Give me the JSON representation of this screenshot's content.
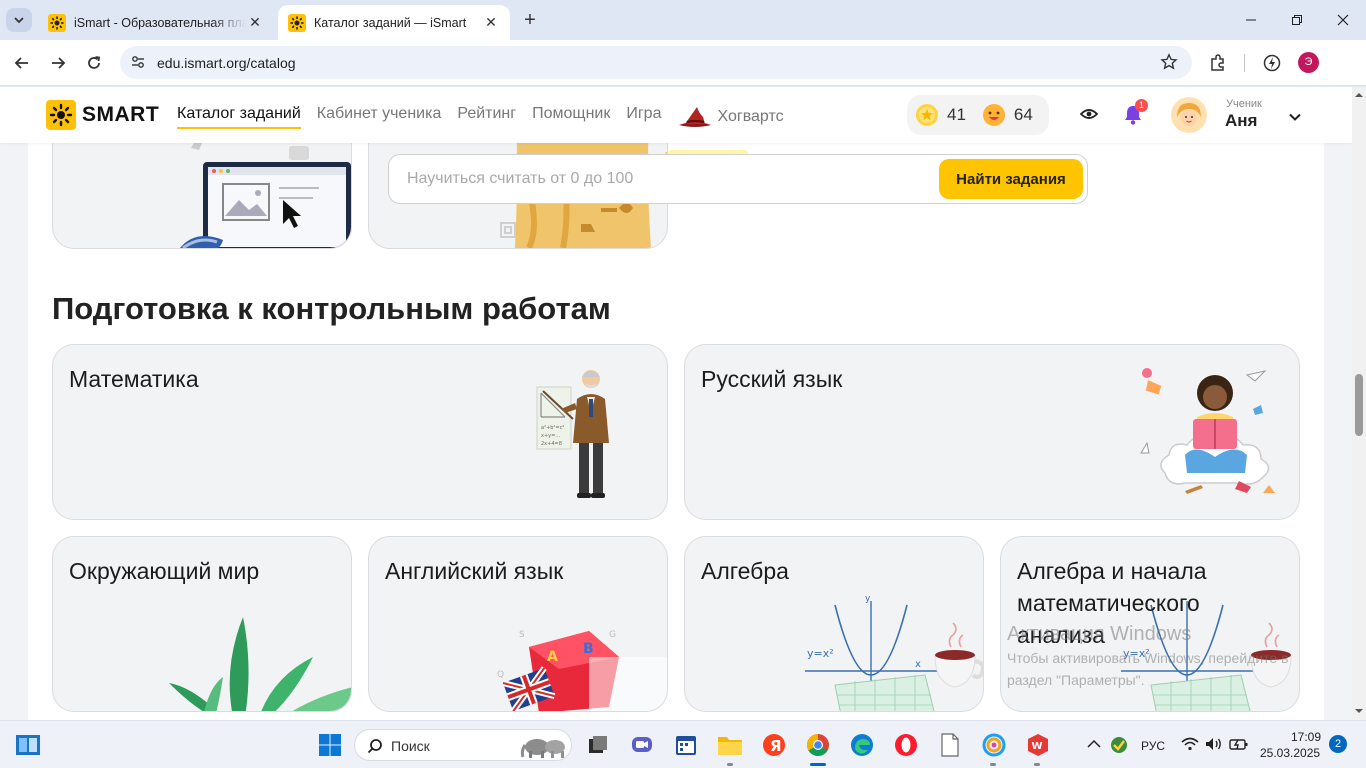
{
  "browser": {
    "tabs": [
      {
        "title": "iSmart - Образовательная платформа",
        "active": false
      },
      {
        "title": "Каталог заданий — iSmart",
        "active": true
      }
    ],
    "url": "edu.ismart.org/catalog",
    "profile_initial": "Э"
  },
  "site": {
    "logo_text": "SMART",
    "nav": [
      "Каталог заданий",
      "Кабинет ученика",
      "Рейтинг",
      "Помощник",
      "Игра",
      "Хогвартс"
    ],
    "coins": "41",
    "smiles": "64",
    "notifications": "1",
    "user_role": "Ученик",
    "user_name": "Аня"
  },
  "search": {
    "placeholder": "Научиться считать от 0 до 100",
    "button": "Найти задания"
  },
  "section": {
    "title": "Подготовка к контрольным работам",
    "cards": [
      "Математика",
      "Русский язык",
      "Окружающий мир",
      "Английский язык",
      "Алгебра",
      "Алгебра и начала математического анализа"
    ]
  },
  "watermark": {
    "line1": "Активация Windows",
    "line2": "Чтобы активировать Windows, перейдите в",
    "line3": "раздел \"Параметры\"."
  },
  "taskbar": {
    "search_label": "Поиск",
    "lang": "РУС",
    "time": "17:09",
    "date": "25.03.2025",
    "notifications": "2"
  },
  "colors": {
    "accent": "#ffc400",
    "chrome_bg": "#dfe6f4",
    "card_bg": "#f2f3f5"
  }
}
